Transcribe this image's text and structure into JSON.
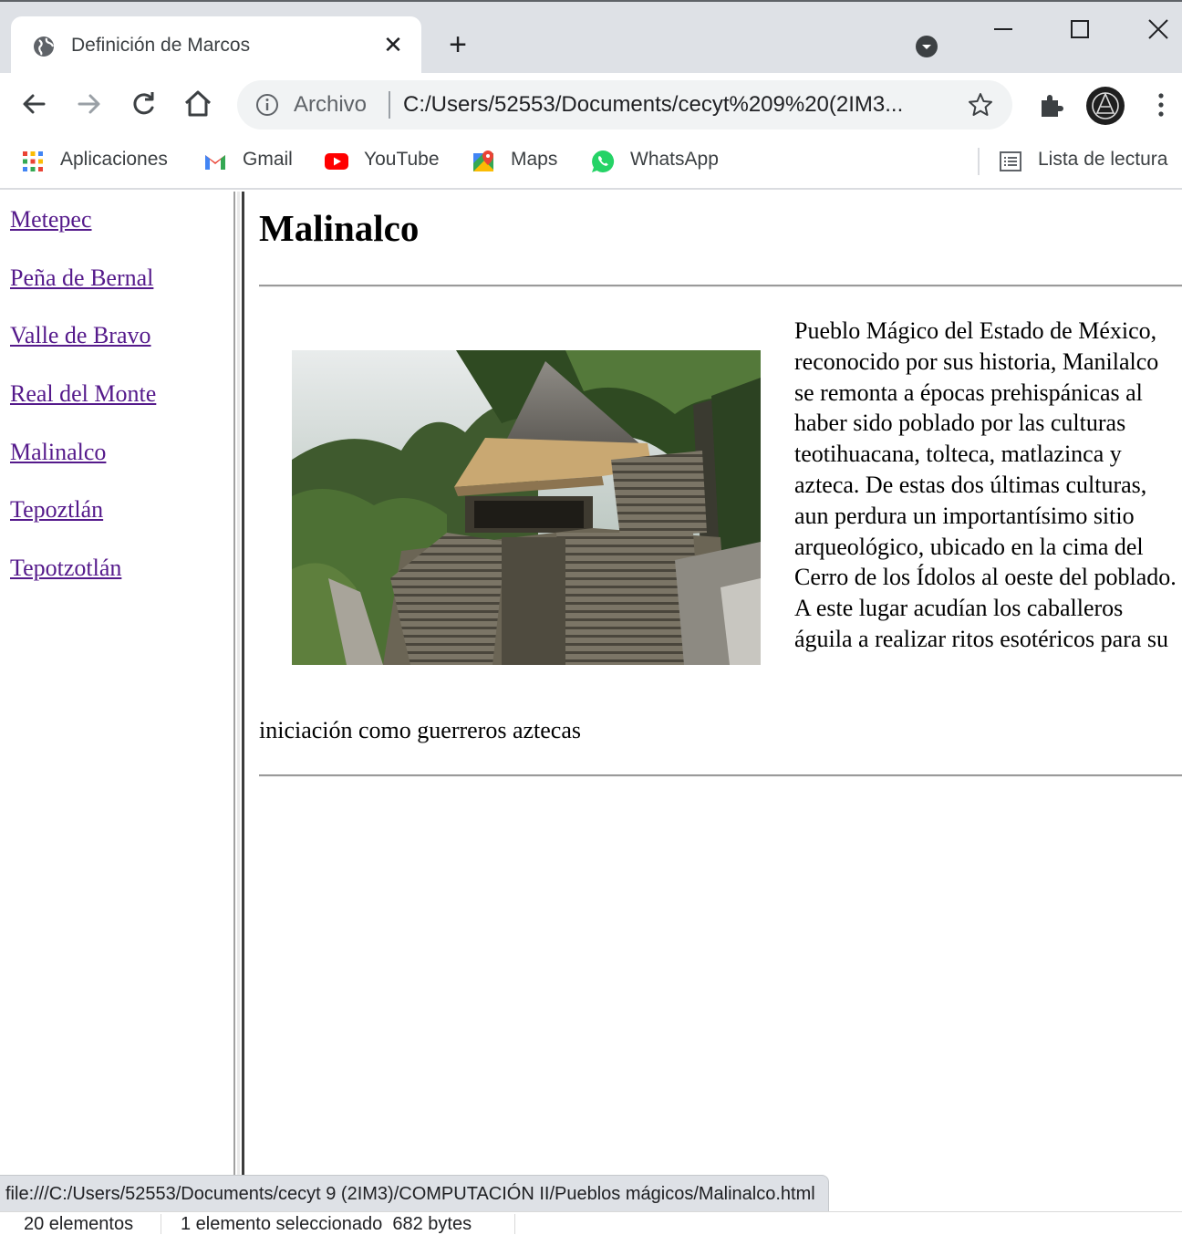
{
  "browser": {
    "tab": {
      "title": "Definición de Marcos",
      "close_glyph": "✕",
      "icon": "globe-icon"
    },
    "new_tab_glyph": "+",
    "window_controls": [
      "minimize-icon",
      "maximize-icon",
      "close-icon"
    ],
    "omnibox": {
      "scheme_label": "Archivo",
      "url": "C:/Users/52553/Documents/cecyt%209%20(2IM3..."
    },
    "bookmarks": [
      {
        "label": "Aplicaciones",
        "icon": "apps-grid-icon"
      },
      {
        "label": "Gmail",
        "icon": "gmail-icon"
      },
      {
        "label": "YouTube",
        "icon": "youtube-icon"
      },
      {
        "label": "Maps",
        "icon": "maps-icon"
      },
      {
        "label": "WhatsApp",
        "icon": "whatsapp-icon"
      }
    ],
    "reading_list": {
      "label": "Lista de lectura",
      "icon": "reading-list-icon"
    }
  },
  "nav_frame": {
    "links": [
      "Metepec",
      "Peña de Bernal",
      "Valle de Bravo",
      "Real del Monte",
      "Malinalco",
      "Tepoztlán",
      "Tepotzotlán"
    ]
  },
  "content": {
    "heading": "Malinalco",
    "paragraph_float": "Pueblo Mágico del Estado de México, reconocido por sus historia, Manilalco se remonta a épocas prehispánicas al haber sido poblado por las culturas teotihuacana, tolteca, matlazinca y azteca. De estas dos últimas culturas, aun perdura un importantísimo sitio arqueológico, ubicado en la cima del Cerro de los Ídolos al oeste del poblado. A este lugar acudían los caballeros águila a realizar ritos esotéricos para su",
    "paragraph_tail": "iniciación como guerreros aztecas"
  },
  "status_bar": {
    "hover_url": "file:///C:/Users/52553/Documents/cecyt 9 (2IM3)/COMPUTACIÓN II/Pueblos mágicos/Malinalco.html"
  },
  "explorer_status": {
    "count": "20 elementos",
    "selected": "1 elemento seleccionado  682 bytes"
  },
  "colors": {
    "link_visited": "#551a8b",
    "tabstrip_bg": "#dee1e6",
    "omnibox_bg": "#f1f3f4"
  }
}
